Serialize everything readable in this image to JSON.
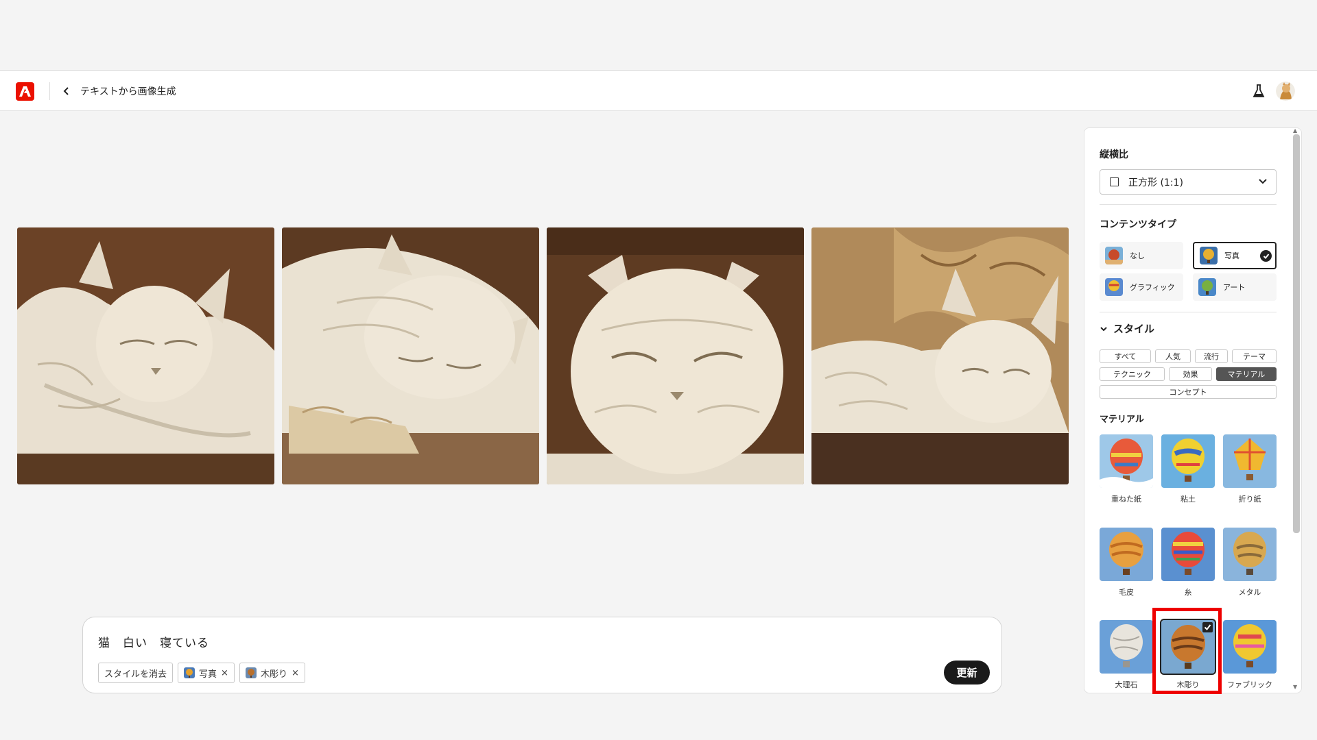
{
  "header": {
    "title": "テキストから画像生成"
  },
  "gallery": {
    "images": [
      {
        "alt": "cat-carving-1"
      },
      {
        "alt": "cat-carving-2"
      },
      {
        "alt": "cat-carving-3"
      },
      {
        "alt": "cat-carving-4"
      }
    ]
  },
  "prompt": {
    "text": "猫　白い　寝ている",
    "clear_label": "スタイルを消去",
    "chips": [
      {
        "label": "写真",
        "remove": "×"
      },
      {
        "label": "木彫り",
        "remove": "×"
      }
    ],
    "update_label": "更新"
  },
  "panel": {
    "aspect": {
      "label": "縦横比",
      "selected": "正方形 (1:1)"
    },
    "content_type": {
      "label": "コンテンツタイプ",
      "options": [
        "なし",
        "写真",
        "グラフィック",
        "アート"
      ],
      "selected": "写真"
    },
    "style": {
      "label": "スタイル",
      "tabs": [
        "すべて",
        "人気",
        "流行",
        "テーマ",
        "テクニック",
        "効果",
        "マテリアル",
        "コンセプト"
      ],
      "active_tab": "マテリアル"
    },
    "material": {
      "label": "マテリアル",
      "items": [
        "重ねた紙",
        "粘土",
        "折り紙",
        "毛皮",
        "糸",
        "メタル",
        "大理石",
        "木彫り",
        "ファブリック"
      ],
      "selected": "木彫り"
    }
  },
  "colors": {
    "brand": "#eb1000",
    "highlight": "#ee0000",
    "dark_button": "#1a1a1a"
  }
}
